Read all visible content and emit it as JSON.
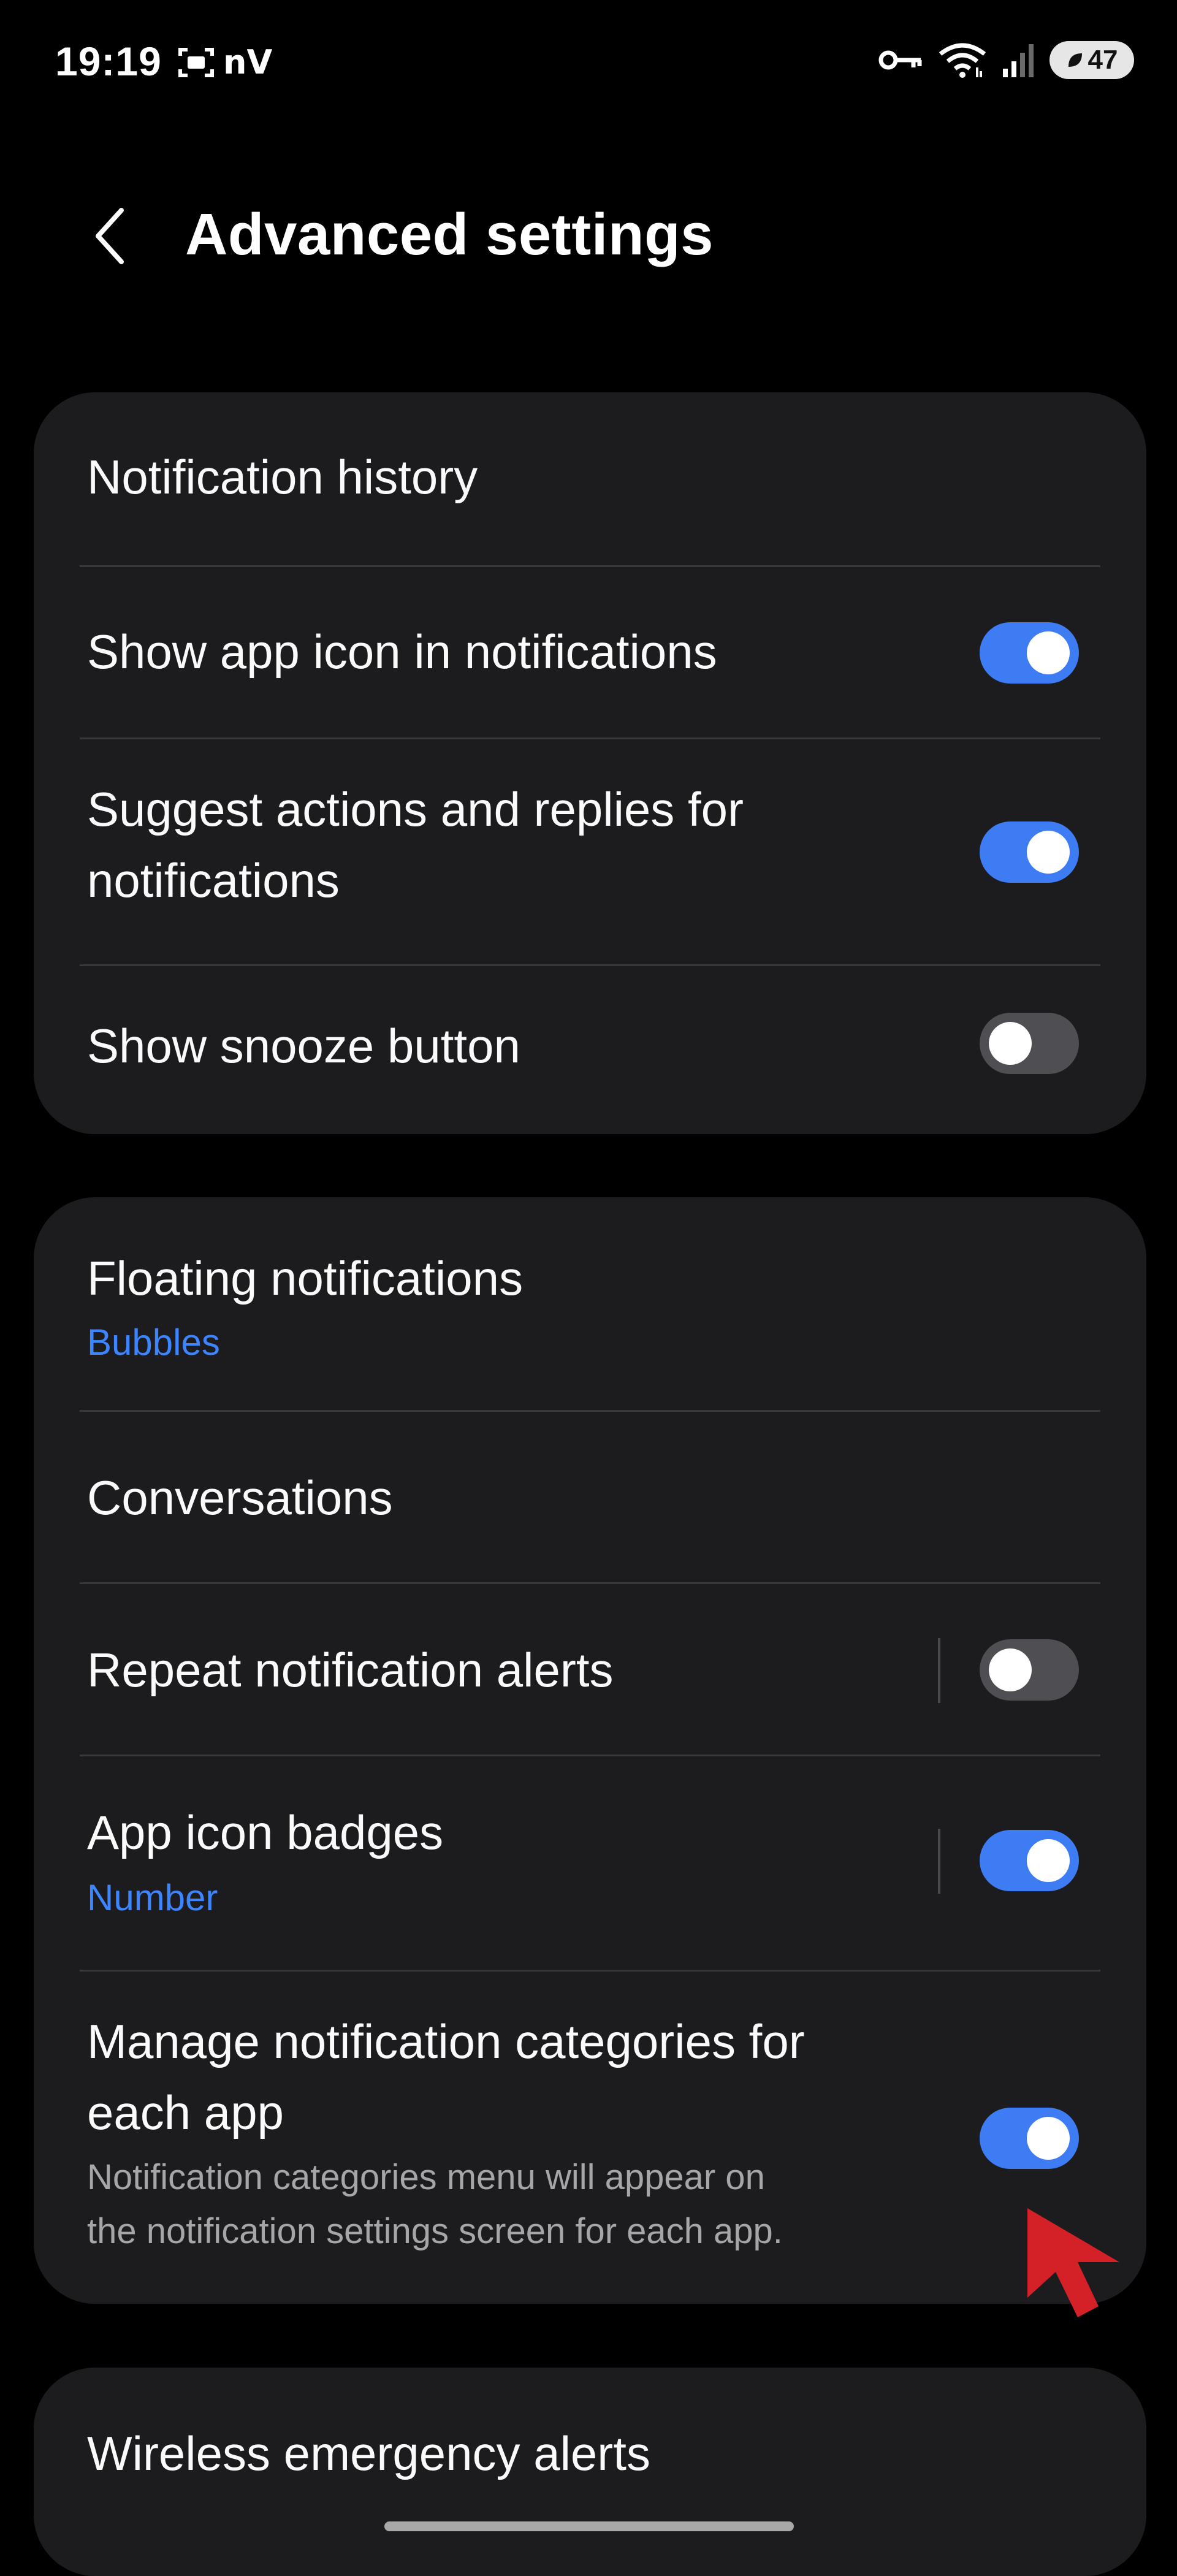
{
  "status_bar": {
    "time": "19:19",
    "carrier_badge": "nV",
    "battery_level": "47",
    "icons": [
      "screen-record-icon",
      "key-icon",
      "wifi-icon",
      "signal-icon",
      "battery-icon"
    ]
  },
  "header": {
    "title": "Advanced settings",
    "back_icon": "chevron-left-icon"
  },
  "section1": {
    "notification_history": {
      "label": "Notification history"
    },
    "show_app_icon": {
      "label": "Show app icon in notifications",
      "enabled": true
    },
    "suggest_actions": {
      "line1": "Suggest actions and replies for",
      "line2": "notifications",
      "enabled": true
    },
    "snooze_button": {
      "label": "Show snooze button",
      "enabled": false
    }
  },
  "section2": {
    "floating_notifications": {
      "label": "Floating notifications",
      "value": "Bubbles"
    },
    "conversations": {
      "label": "Conversations"
    },
    "repeat_alerts": {
      "label": "Repeat notification alerts",
      "enabled": false
    },
    "app_icon_badges": {
      "label": "App icon badges",
      "value": "Number",
      "enabled": true
    },
    "manage_categories": {
      "line1": "Manage notification categories for",
      "line2": "each app",
      "desc_line1": "Notification categories menu will appear on",
      "desc_line2": "the notification settings screen for each app.",
      "enabled": true
    }
  },
  "section3": {
    "wireless_alerts": {
      "label": "Wireless emergency alerts"
    }
  },
  "colors": {
    "background": "#000000",
    "card": "#1c1c1f",
    "accent_blue": "#3e7cf3",
    "link_blue": "#3d84ff",
    "cursor_red": "#d42027"
  }
}
